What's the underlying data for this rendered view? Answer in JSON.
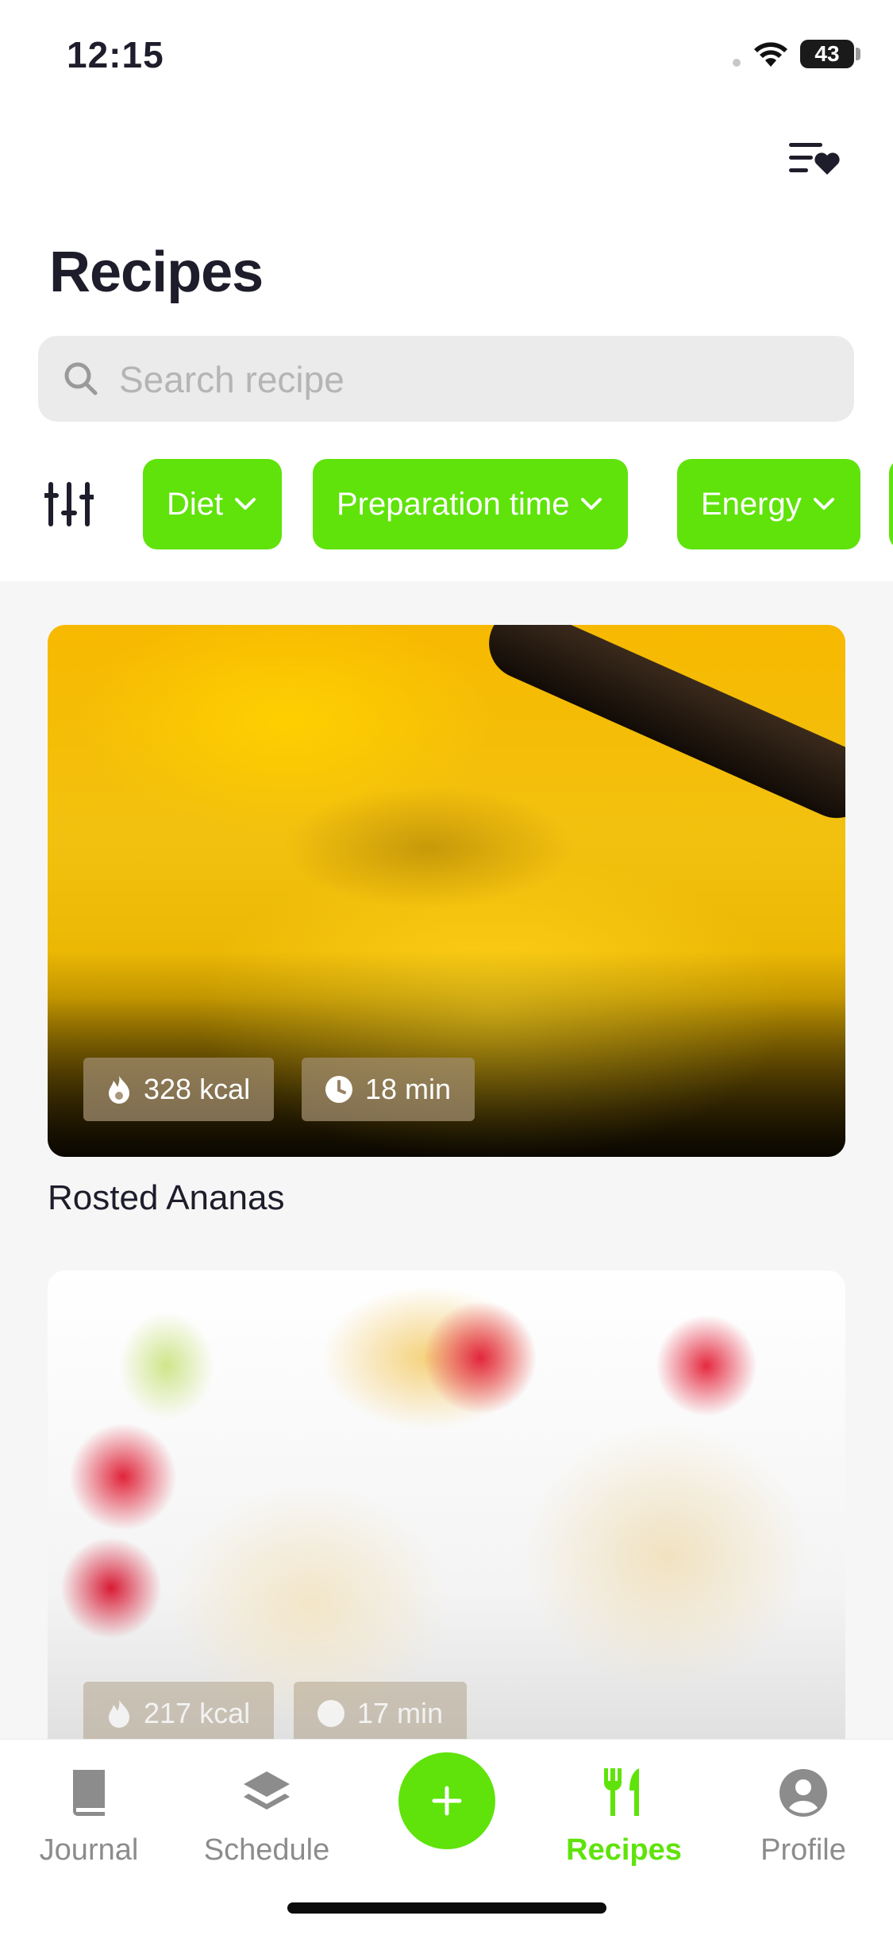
{
  "status_bar": {
    "time": "12:15",
    "battery": "43"
  },
  "header": {
    "title": "Recipes"
  },
  "search": {
    "placeholder": "Search recipe",
    "value": ""
  },
  "filters": [
    {
      "label": "Diet"
    },
    {
      "label": "Preparation time"
    },
    {
      "label": "Energy"
    }
  ],
  "recipes": [
    {
      "name": "Rosted Ananas",
      "kcal": "328 kcal",
      "time": "18 min"
    },
    {
      "name": "",
      "kcal": "217 kcal",
      "time": "17 min"
    }
  ],
  "tabbar": {
    "journal": "Journal",
    "schedule": "Schedule",
    "recipes": "Recipes",
    "profile": "Profile"
  },
  "colors": {
    "accent": "#5fe30a",
    "text": "#1d1d2b",
    "muted": "#8c8c8c",
    "feed_bg": "#f6f6f6"
  },
  "icons": [
    "wifi-icon",
    "battery-icon",
    "favorites-list-icon",
    "search-icon",
    "filter-adjust-icon",
    "chevron-down-icon",
    "flame-icon",
    "clock-icon",
    "book-icon",
    "layers-icon",
    "plus-icon",
    "fork-knife-icon",
    "user-icon"
  ]
}
